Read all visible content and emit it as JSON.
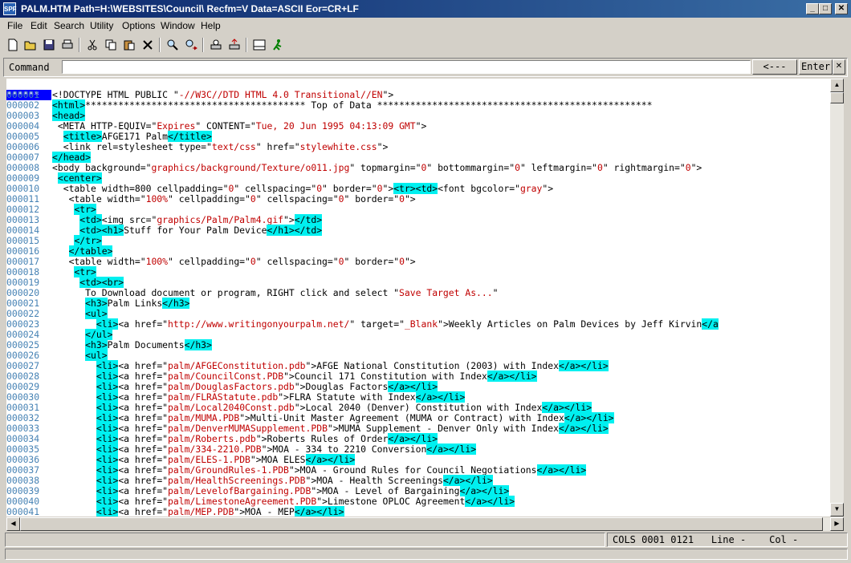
{
  "window": {
    "app_icon": "SPF",
    "title": "PALM.HTM  Path=H:\\WEBSITES\\Council\\  Recfm=V  Data=ASCII  Eor=CR+LF",
    "minimize": "_",
    "maximize": "□",
    "close": "✕"
  },
  "menu": [
    "File",
    "Edit",
    "Search",
    "Utility",
    "Options",
    "Window",
    "Help"
  ],
  "toolbar": {
    "icons": [
      "new-file-icon",
      "open-folder-icon",
      "save-icon",
      "print-icon",
      "cut-icon",
      "copy-icon",
      "paste-icon",
      "delete-icon",
      "find-icon",
      "replace-icon",
      "print-preview-icon",
      "export-icon",
      "ascii-table-icon",
      "run-icon"
    ]
  },
  "command": {
    "label": "Command",
    "value": "",
    "back_label": "<---",
    "enter_label": "Enter",
    "close_label": "✕"
  },
  "editor": {
    "top_prefix": "******",
    "top_line": "********************************************** Top of Data **************************************************",
    "lines": [
      {
        "n": "000001",
        "t": "<!DOCTYPE HTML PUBLIC \"-//W3C//DTD HTML 4.0 Transitional//EN\">"
      },
      {
        "n": "000002",
        "t": "<html>"
      },
      {
        "n": "000003",
        "t": "<head>"
      },
      {
        "n": "000004",
        "t": " <META HTTP-EQUIV=\"Expires\" CONTENT=\"Tue, 20 Jun 1995 04:13:09 GMT\">"
      },
      {
        "n": "000005",
        "t": "  <title>AFGE171 Palm</title>"
      },
      {
        "n": "000006",
        "t": "  <link rel=stylesheet type=\"text/css\" href=\"stylewhite.css\">"
      },
      {
        "n": "000007",
        "t": "</head>"
      },
      {
        "n": "000008",
        "t": "<body background=\"graphics/background/Texture/o011.jpg\" topmargin=\"0\" bottommargin=\"0\" leftmargin=\"0\" rightmargin=\"0\">"
      },
      {
        "n": "000009",
        "t": " <center>"
      },
      {
        "n": "000010",
        "t": "  <table width=800 cellpadding=\"0\" cellspacing=\"0\" border=\"0\"><tr><td><font bgcolor=\"gray\">"
      },
      {
        "n": "000011",
        "t": "   <table width=\"100%\" cellpadding=\"0\" cellspacing=\"0\" border=\"0\">"
      },
      {
        "n": "000012",
        "t": "    <tr>"
      },
      {
        "n": "000013",
        "t": "     <td><img src=\"graphics/Palm/Palm4.gif\"></td>"
      },
      {
        "n": "000014",
        "t": "     <td><h1>Stuff for Your Palm Device</h1></td>"
      },
      {
        "n": "000015",
        "t": "    </tr>"
      },
      {
        "n": "000016",
        "t": "   </table>"
      },
      {
        "n": "000017",
        "t": "   <table width=\"100%\" cellpadding=\"0\" cellspacing=\"0\" border=\"0\">"
      },
      {
        "n": "000018",
        "t": "    <tr>"
      },
      {
        "n": "000019",
        "t": "     <td><br>"
      },
      {
        "n": "000020",
        "t": "      To Download document or program, RIGHT click and select \"Save Target As...\""
      },
      {
        "n": "000021",
        "t": "      <h3>Palm Links</h3>"
      },
      {
        "n": "000022",
        "t": "      <ul>"
      },
      {
        "n": "000023",
        "t": "        <li><a href=\"http://www.writingonyourpalm.net/\" target=\"_Blank\">Weekly Articles on Palm Devices by Jeff Kirvin</a"
      },
      {
        "n": "000024",
        "t": "      </ul>"
      },
      {
        "n": "000025",
        "t": "      <h3>Palm Documents</h3>"
      },
      {
        "n": "000026",
        "t": "      <ul>"
      },
      {
        "n": "000027",
        "t": "        <li><a href=\"palm/AFGEConstitution.pdb\">AFGE National Constitution (2003) with Index</a></li>"
      },
      {
        "n": "000028",
        "t": "        <li><a href=\"palm/CouncilConst.PDB\">Council 171 Constitution with Index</a></li>"
      },
      {
        "n": "000029",
        "t": "        <li><a href=\"palm/DouglasFactors.pdb\">Douglas Factors</a></li>"
      },
      {
        "n": "000030",
        "t": "        <li><a href=\"palm/FLRAStatute.pdb\">FLRA Statute with Index</a></li>"
      },
      {
        "n": "000031",
        "t": "        <li><a href=\"palm/Local2040Const.pdb\">Local 2040 (Denver) Constitution with Index</a></li>"
      },
      {
        "n": "000032",
        "t": "        <li><a href=\"palm/MUMA.PDB\">Multi-Unit Master Agreement (MUMA or Contract) with Index</a></li>"
      },
      {
        "n": "000033",
        "t": "        <li><a href=\"palm/DenverMUMASupplement.PDB\">MUMA Supplement - Denver Only with Index</a></li>"
      },
      {
        "n": "000034",
        "t": "        <li><a href=\"palm/Roberts.pdb\">Roberts Rules of Order</a></li>"
      },
      {
        "n": "000035",
        "t": "        <li><a href=\"palm/334-2210.PDB\">MOA - 334 to 2210 Conversion</a></li>"
      },
      {
        "n": "000036",
        "t": "        <li><a href=\"palm/ELES-1.PDB\">MOA ELES</a></li>"
      },
      {
        "n": "000037",
        "t": "        <li><a href=\"palm/GroundRules-1.PDB\">MOA - Ground Rules for Council Negotiations</a></li>"
      },
      {
        "n": "000038",
        "t": "        <li><a href=\"palm/HealthScreenings.PDB\">MOA - Health Screenings</a></li>"
      },
      {
        "n": "000039",
        "t": "        <li><a href=\"palm/LevelofBargaining.PDB\">MOA - Level of Bargaining</a></li>"
      },
      {
        "n": "000040",
        "t": "        <li><a href=\"palm/LimestoneAgreement.PDB\">Limestone OPLOC Agreement</a></li>"
      },
      {
        "n": "000041",
        "t": "        <li><a href=\"palm/MEP.PDB\">MOA - MEP</a></li>"
      }
    ]
  },
  "status": {
    "cols": "COLS 0001 0121",
    "line": "Line -",
    "col": "Col -"
  },
  "colors": {
    "tag_highlight": "#00f0f0",
    "string": "#c00000",
    "line_numbers": "#4682b4",
    "title_bar": "#0a246a"
  }
}
